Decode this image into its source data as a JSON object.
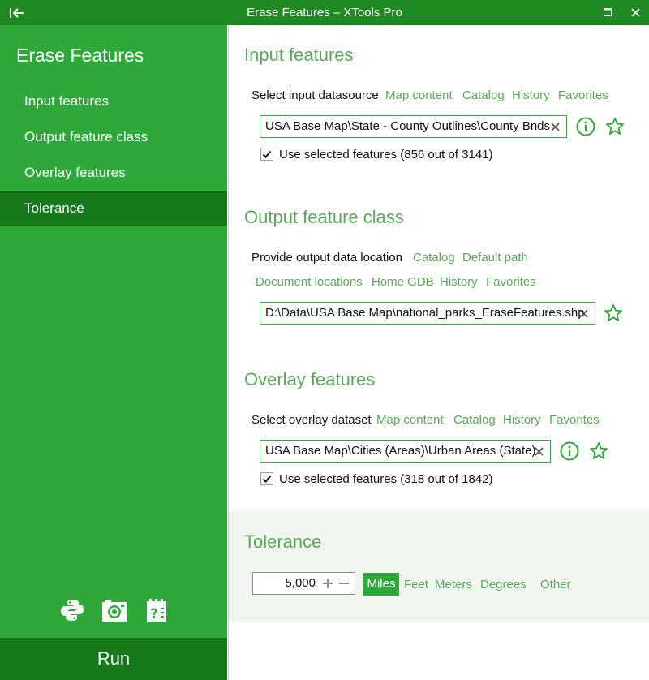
{
  "window": {
    "title": "Erase Features – XTools Pro"
  },
  "sidebar": {
    "title": "Erase Features",
    "items": [
      {
        "label": "Input features"
      },
      {
        "label": "Output feature class"
      },
      {
        "label": "Overlay features"
      },
      {
        "label": "Tolerance",
        "active": true
      }
    ],
    "tools": [
      "python-icon",
      "camera-icon",
      "help-icon"
    ],
    "run_label": "Run"
  },
  "input": {
    "title": "Input features",
    "label": "Select input datasource",
    "links": [
      "Map content",
      "Catalog",
      "History",
      "Favorites"
    ],
    "value": "USA Base Map\\State - County Outlines\\County Bnds",
    "use_selected": "Use selected features (856 out of 3141)",
    "checked": true
  },
  "output": {
    "title": "Output feature class",
    "label": "Provide output data location",
    "links_row1": [
      "Catalog",
      "Default path"
    ],
    "links_row2": [
      "Document locations",
      "Home GDB",
      "History",
      "Favorites"
    ],
    "value": "D:\\Data\\USA Base Map\\national_parks_EraseFeatures.shp"
  },
  "overlay": {
    "title": "Overlay features",
    "label": "Select overlay dataset",
    "links": [
      "Map content",
      "Catalog",
      "History",
      "Favorites"
    ],
    "value": "USA Base Map\\Cities (Areas)\\Urban Areas (State)",
    "use_selected": "Use selected features (318 out of 1842)",
    "checked": true
  },
  "tolerance": {
    "title": "Tolerance",
    "value": "5,000",
    "units": [
      "Miles",
      "Feet",
      "Meters",
      "Degrees",
      "Other"
    ],
    "selected_unit": "Miles"
  },
  "colors": {
    "accent": "#2fa83a",
    "accent_dark": "#167a1d",
    "titlebar": "#1f8a24",
    "link": "#5ba85b"
  }
}
